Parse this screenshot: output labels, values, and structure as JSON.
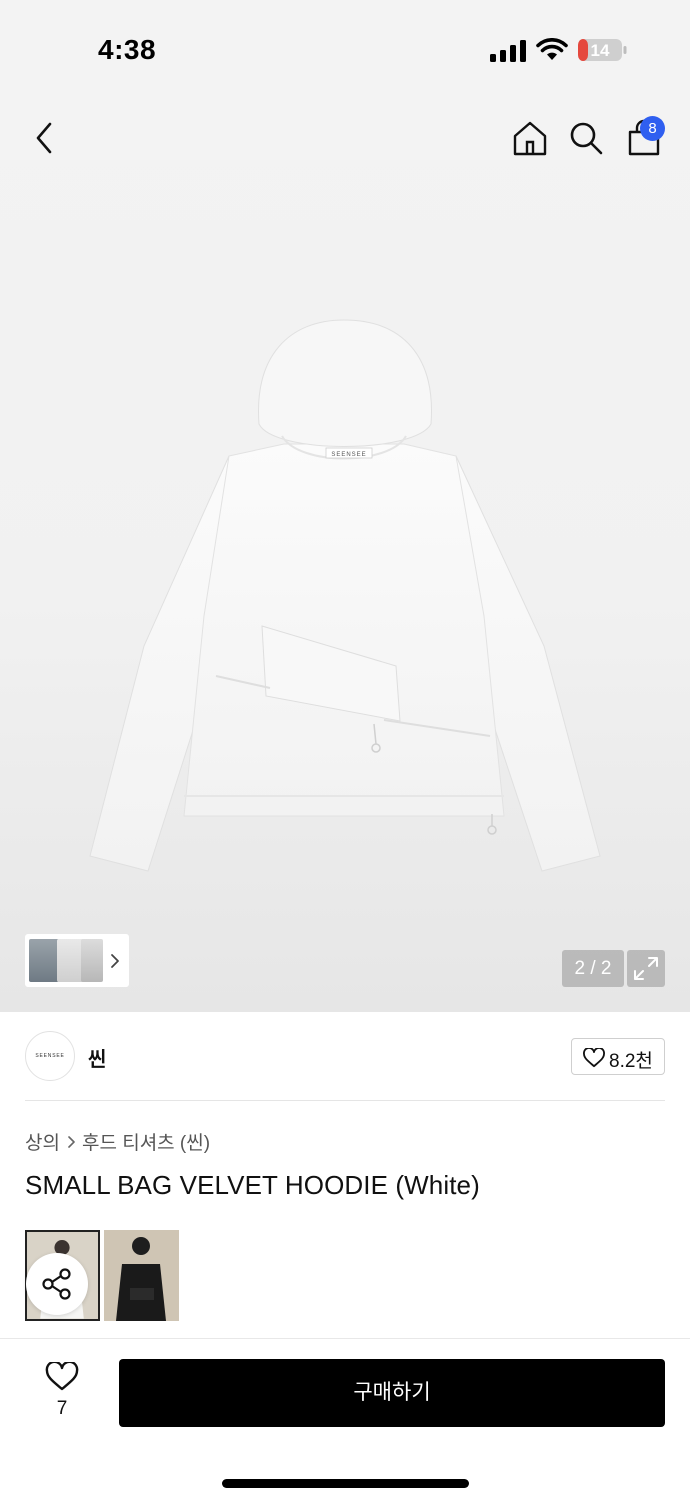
{
  "status_bar": {
    "time": "4:38",
    "battery": "14"
  },
  "header": {
    "cart_count": "8",
    "icons": [
      "back-icon",
      "home-icon",
      "search-icon",
      "cart-icon"
    ]
  },
  "gallery": {
    "page_counter": "2 / 2",
    "hoodie_label": "SEENSEE"
  },
  "brand": {
    "logo_text": "SEENSEE",
    "name": "씬",
    "likes": "8.2천"
  },
  "breadcrumb": {
    "category": "상의",
    "subcategory": "후드 티셔츠 (씬)"
  },
  "product": {
    "title": "SMALL BAG VELVET HOODIE (White)"
  },
  "bottom": {
    "wish_count": "7",
    "buy_label": "구매하기"
  },
  "colors": {
    "accent": "#2f5ff0",
    "battery_low": "#e5483d",
    "buy_button": "#000000"
  }
}
